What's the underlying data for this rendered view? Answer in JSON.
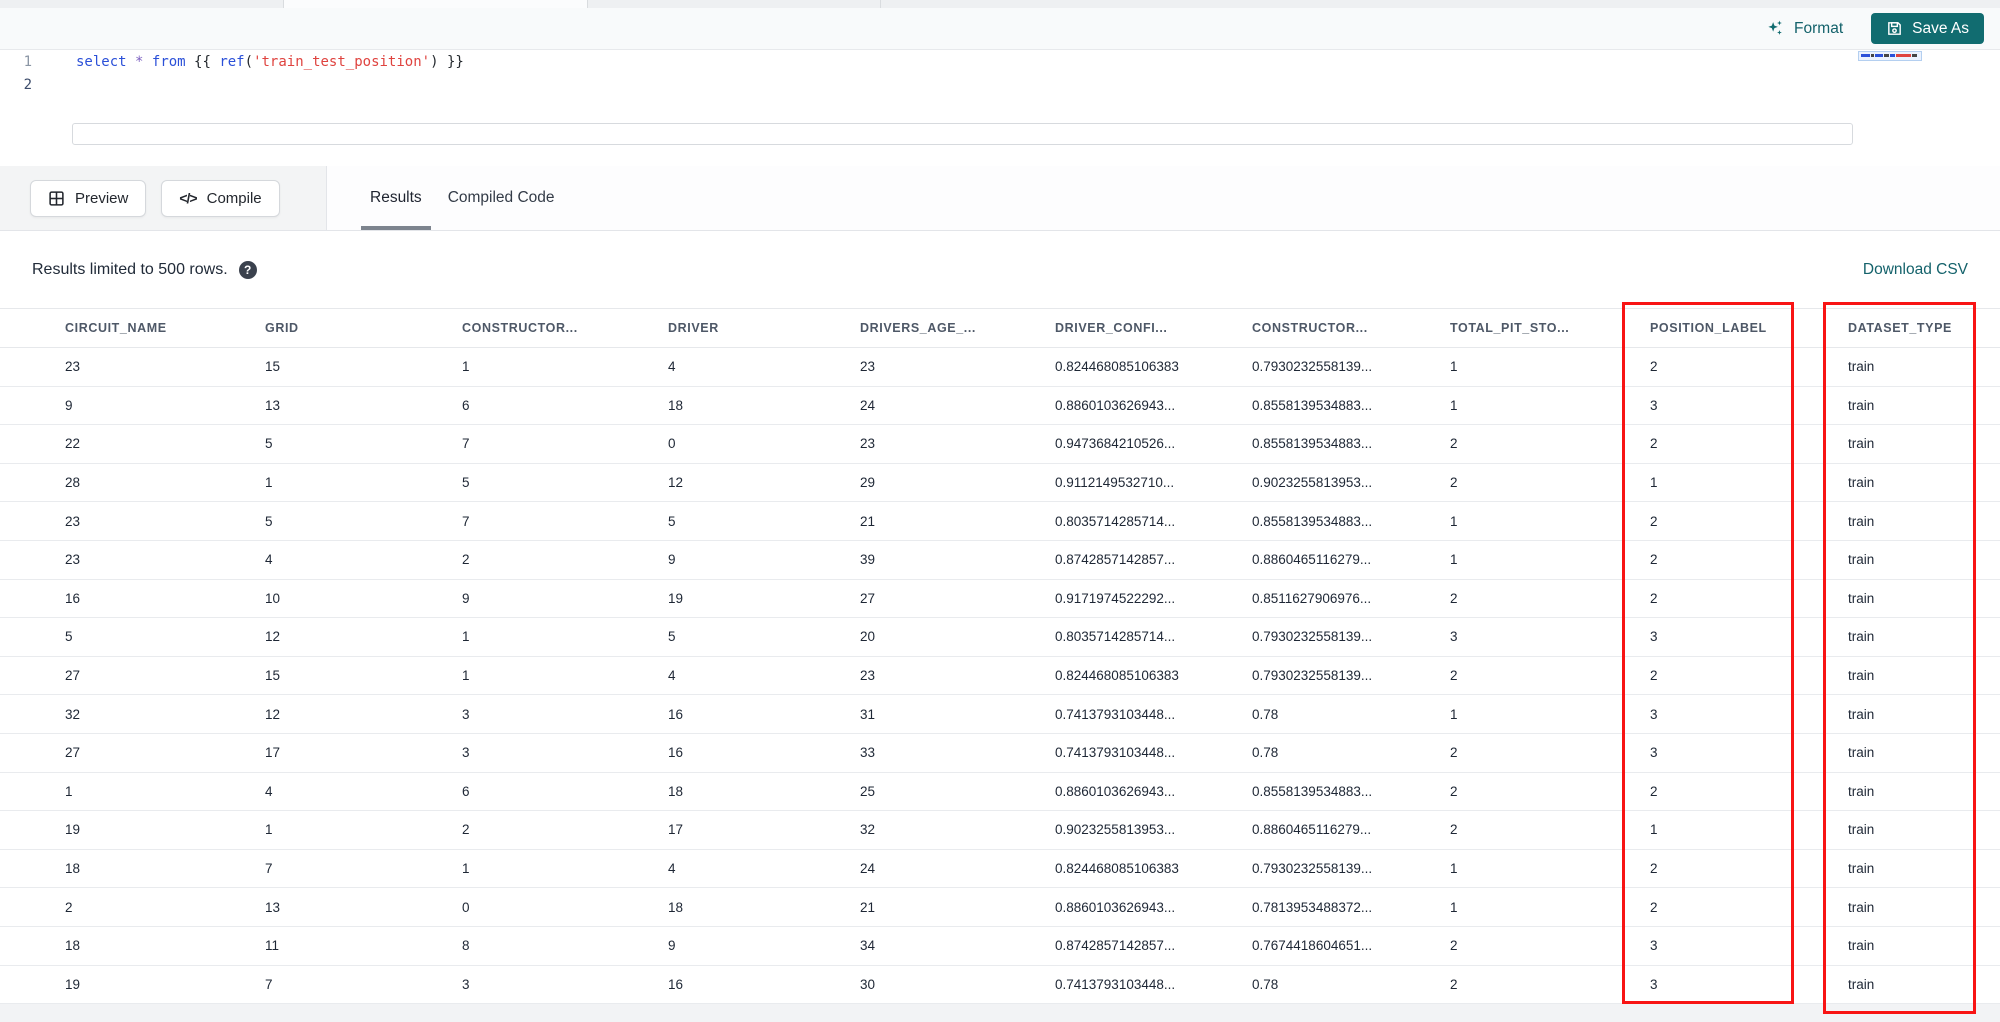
{
  "toolbar": {
    "format_label": "Format",
    "save_as_label": "Save As"
  },
  "editor": {
    "line_numbers": [
      "1",
      "2"
    ],
    "code_tokens": [
      {
        "text": "select",
        "type": "kw"
      },
      {
        "text": " ",
        "type": "plain"
      },
      {
        "text": "*",
        "type": "op"
      },
      {
        "text": " ",
        "type": "plain"
      },
      {
        "text": "from",
        "type": "kw"
      },
      {
        "text": " {{ ",
        "type": "plain"
      },
      {
        "text": "ref",
        "type": "kw"
      },
      {
        "text": "(",
        "type": "plain"
      },
      {
        "text": "'train_test_position'",
        "type": "str"
      },
      {
        "text": ")",
        "type": "plain"
      },
      {
        "text": " }}",
        "type": "plain"
      }
    ],
    "full_line": "select * from {{ ref('train_test_position') }}"
  },
  "action_bar": {
    "preview_label": "Preview",
    "compile_label": "Compile",
    "compile_glyph": "</>"
  },
  "tabs": [
    {
      "label": "Results",
      "active": true
    },
    {
      "label": "Compiled Code",
      "active": false
    }
  ],
  "results_bar": {
    "message": "Results limited to 500 rows.",
    "help_glyph": "?",
    "download_label": "Download CSV"
  },
  "table": {
    "columns": [
      "CIRCUIT_NAME",
      "GRID",
      "CONSTRUCTOR...",
      "DRIVER",
      "DRIVERS_AGE_...",
      "DRIVER_CONFI...",
      "CONSTRUCTOR...",
      "TOTAL_PIT_STO...",
      "POSITION_LABEL",
      "DATASET_TYPE"
    ],
    "highlighted_columns": [
      "POSITION_LABEL",
      "DATASET_TYPE"
    ],
    "rows": [
      [
        "23",
        "15",
        "1",
        "4",
        "23",
        "0.824468085106383",
        "0.7930232558139...",
        "1",
        "2",
        "train"
      ],
      [
        "9",
        "13",
        "6",
        "18",
        "24",
        "0.8860103626943...",
        "0.8558139534883...",
        "1",
        "3",
        "train"
      ],
      [
        "22",
        "5",
        "7",
        "0",
        "23",
        "0.9473684210526...",
        "0.8558139534883...",
        "2",
        "2",
        "train"
      ],
      [
        "28",
        "1",
        "5",
        "12",
        "29",
        "0.9112149532710...",
        "0.9023255813953...",
        "2",
        "1",
        "train"
      ],
      [
        "23",
        "5",
        "7",
        "5",
        "21",
        "0.8035714285714...",
        "0.8558139534883...",
        "1",
        "2",
        "train"
      ],
      [
        "23",
        "4",
        "2",
        "9",
        "39",
        "0.8742857142857...",
        "0.8860465116279...",
        "1",
        "2",
        "train"
      ],
      [
        "16",
        "10",
        "9",
        "19",
        "27",
        "0.9171974522292...",
        "0.8511627906976...",
        "2",
        "2",
        "train"
      ],
      [
        "5",
        "12",
        "1",
        "5",
        "20",
        "0.8035714285714...",
        "0.7930232558139...",
        "3",
        "3",
        "train"
      ],
      [
        "27",
        "15",
        "1",
        "4",
        "23",
        "0.824468085106383",
        "0.7930232558139...",
        "2",
        "2",
        "train"
      ],
      [
        "32",
        "12",
        "3",
        "16",
        "31",
        "0.7413793103448...",
        "0.78",
        "1",
        "3",
        "train"
      ],
      [
        "27",
        "17",
        "3",
        "16",
        "33",
        "0.7413793103448...",
        "0.78",
        "2",
        "3",
        "train"
      ],
      [
        "1",
        "4",
        "6",
        "18",
        "25",
        "0.8860103626943...",
        "0.8558139534883...",
        "2",
        "2",
        "train"
      ],
      [
        "19",
        "1",
        "2",
        "17",
        "32",
        "0.9023255813953...",
        "0.8860465116279...",
        "2",
        "1",
        "train"
      ],
      [
        "18",
        "7",
        "1",
        "4",
        "24",
        "0.824468085106383",
        "0.7930232558139...",
        "1",
        "2",
        "train"
      ],
      [
        "2",
        "13",
        "0",
        "18",
        "21",
        "0.8860103626943...",
        "0.7813953488372...",
        "1",
        "2",
        "train"
      ],
      [
        "18",
        "11",
        "8",
        "9",
        "34",
        "0.8742857142857...",
        "0.7674418604651...",
        "2",
        "3",
        "train"
      ],
      [
        "19",
        "7",
        "3",
        "16",
        "30",
        "0.7413793103448...",
        "0.78",
        "2",
        "3",
        "train"
      ]
    ]
  },
  "colors": {
    "accent_teal": "#116c70",
    "accent_teal_dark": "#14626b",
    "highlight_red": "#f81414",
    "keyword_blue": "#2b50d8",
    "operator_violet": "#7b5fc0",
    "string_red": "#df433f"
  }
}
